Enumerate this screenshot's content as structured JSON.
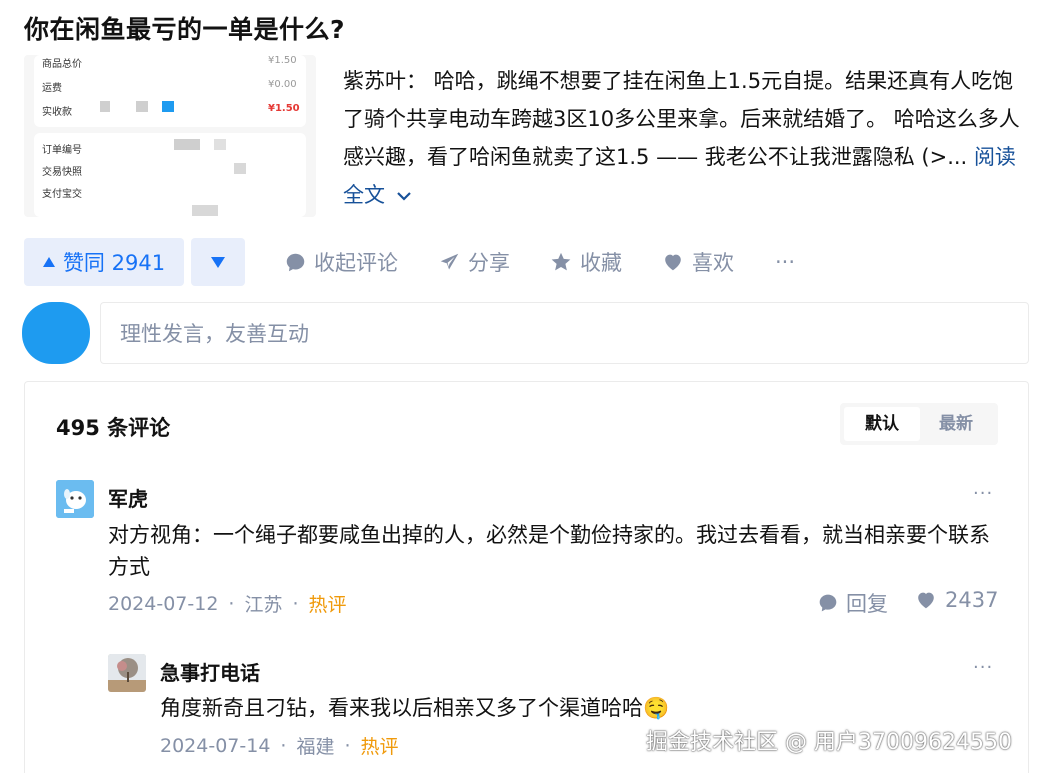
{
  "question": {
    "title": "你在闲鱼最亏的一单是什么?"
  },
  "thumbnail": {
    "rows": [
      {
        "label": "商品总价",
        "value": "¥1.50"
      },
      {
        "label": "运费",
        "value": "¥0.00"
      },
      {
        "label": "实收款",
        "value": "¥1.50"
      },
      {
        "label": "订单编号",
        "value": ""
      },
      {
        "label": "交易快照",
        "value": ""
      },
      {
        "label": "支付宝交",
        "value": ""
      }
    ]
  },
  "answer": {
    "author": "紫苏叶：",
    "excerpt": " 哈哈，跳绳不想要了挂在闲鱼上1.5元自提。结果还真有人吃饱了骑个共享电动车跨越3区10多公里来拿。后来就结婚了。 哈哈这么多人感兴趣，看了哈闲鱼就卖了这1.5 —— 我老公不让我泄露隐私 (>...",
    "read_more": "阅读全文"
  },
  "actions": {
    "vote_up": "赞同 2941",
    "collapse_comments": "收起评论",
    "share": "分享",
    "favorite": "收藏",
    "like": "喜欢",
    "more": "···"
  },
  "comment_input": {
    "placeholder": "理性发言，友善互动"
  },
  "comments": {
    "count_label": "495 条评论",
    "sort_default": "默认",
    "sort_latest": "最新",
    "items": [
      {
        "name": "军虎",
        "text": "对方视角：一个绳子都要咸鱼出掉的人，必然是个勤俭持家的。我过去看看，就当相亲要个联系方式",
        "date": "2024-07-12",
        "location": "江苏",
        "tag": "热评",
        "reply_label": "回复",
        "likes": "2437"
      },
      {
        "name": "急事打电话",
        "text": "角度新奇且刁钻，看来我以后相亲又多了个渠道哈哈🤤",
        "date": "2024-07-14",
        "location": "福建",
        "tag": "热评"
      }
    ]
  },
  "watermark": "掘金技术社区 @ 用户37009624550",
  "colors": {
    "accent": "#1772f6",
    "hot": "#f09a0b",
    "muted": "#8590a6"
  }
}
